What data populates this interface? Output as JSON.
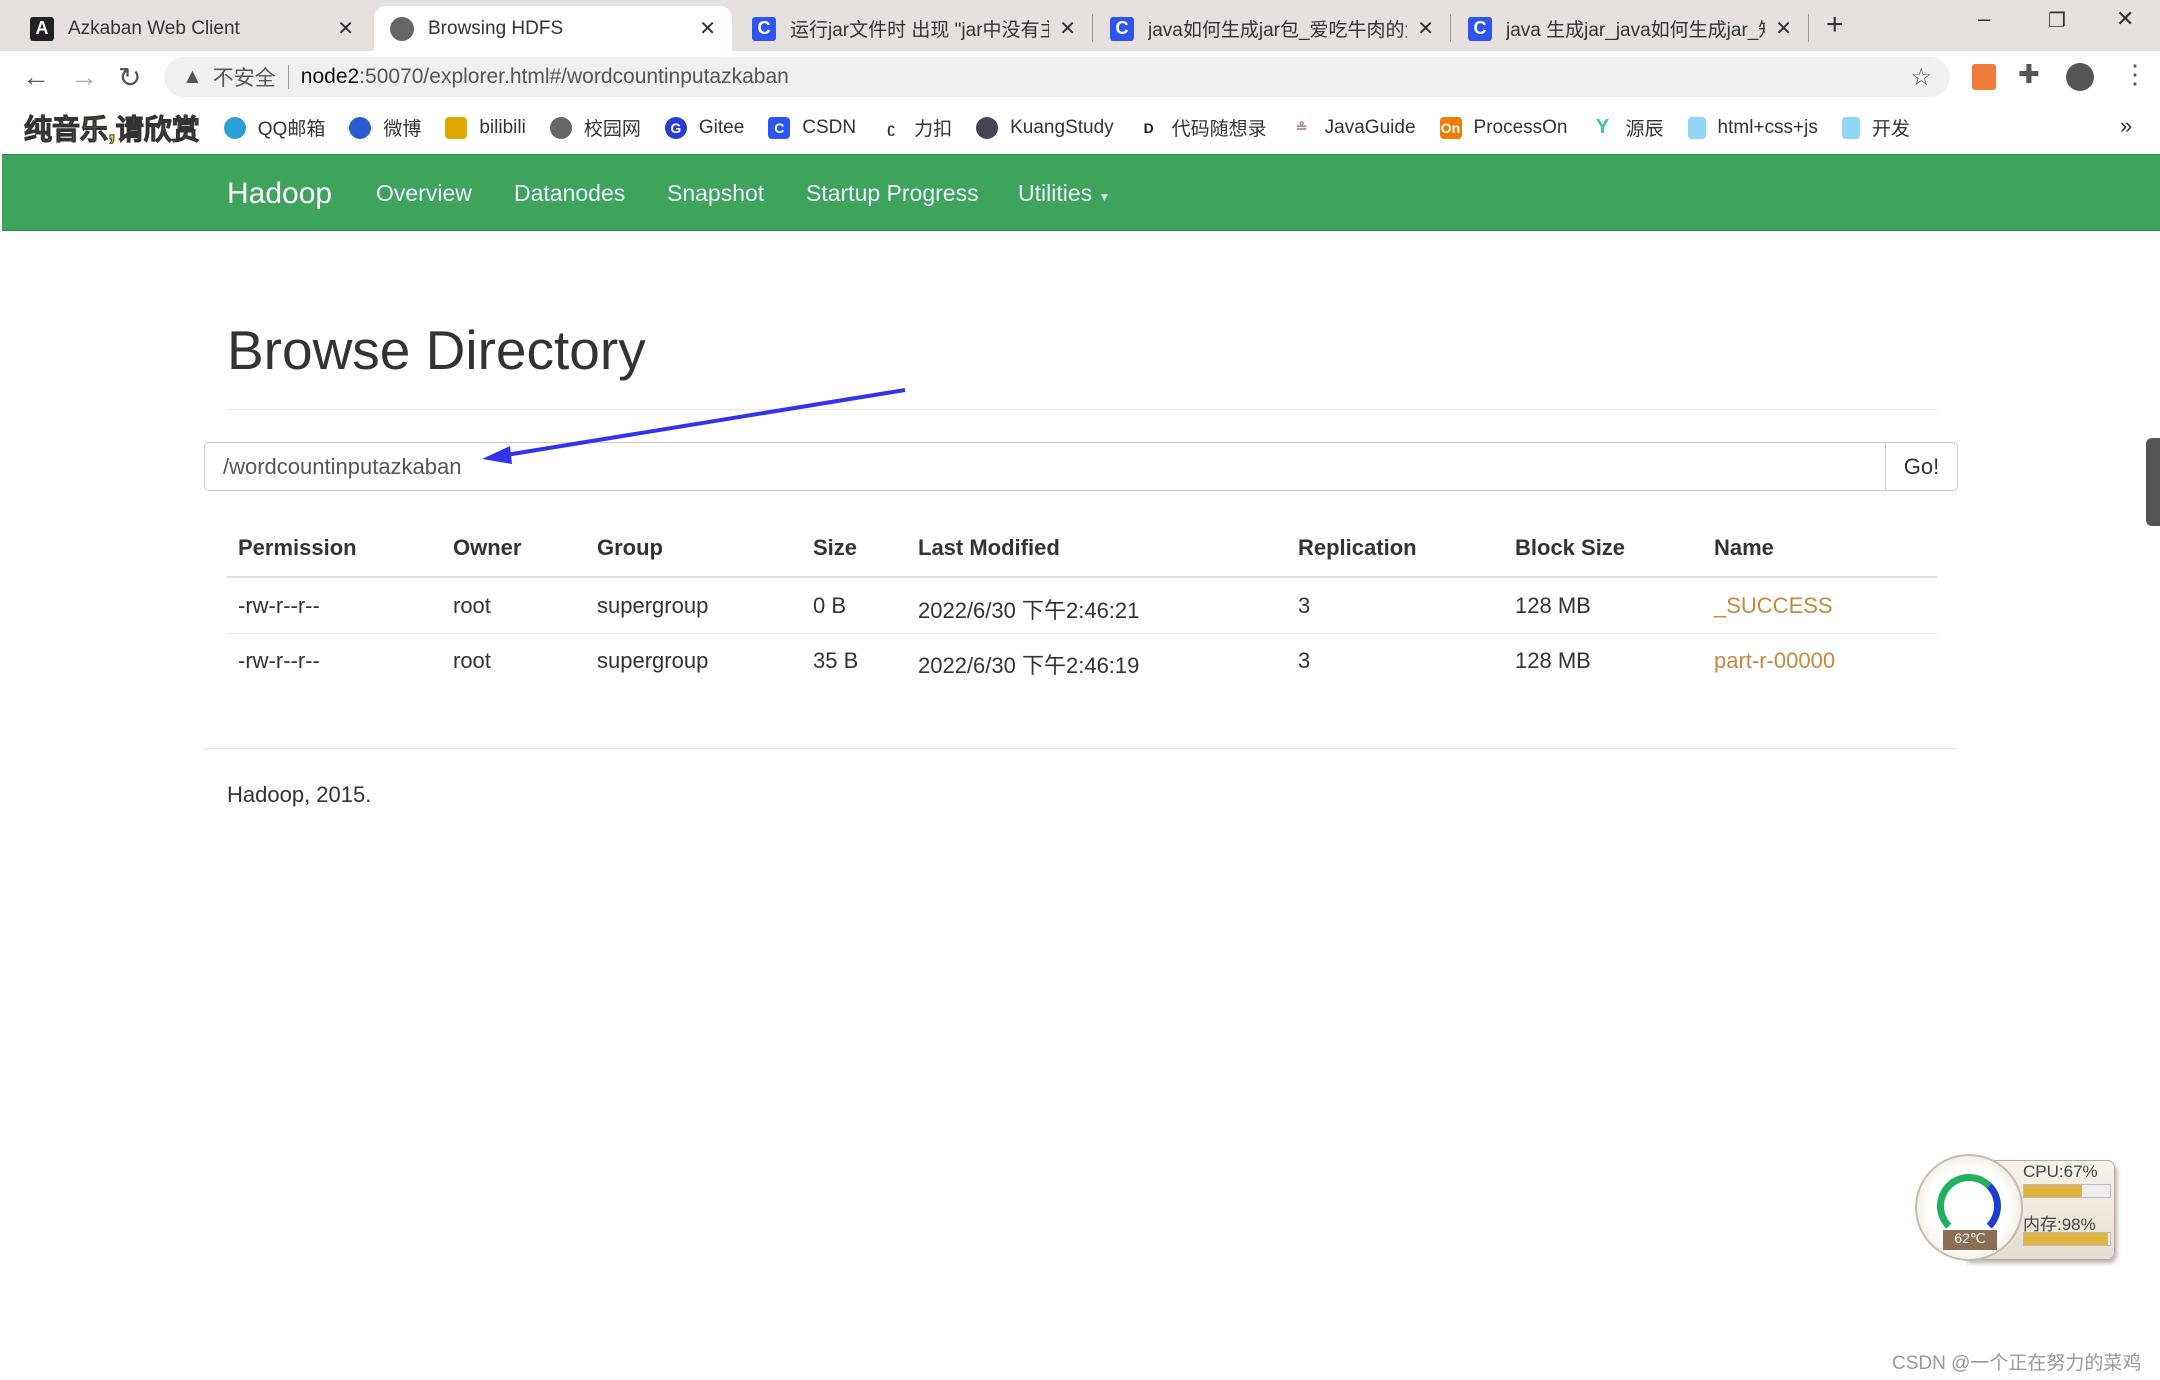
{
  "browser": {
    "tabs": [
      {
        "title": "Azkaban Web Client",
        "icon": "azkaban-icon"
      },
      {
        "title": "Browsing HDFS",
        "icon": "globe-icon",
        "active": true
      },
      {
        "title": "运行jar文件时 出现 \"jar中没有主",
        "icon": "csdn-icon"
      },
      {
        "title": "java如何生成jar包_爱吃牛肉的大",
        "icon": "csdn-icon"
      },
      {
        "title": "java 生成jar_java如何生成jar_知",
        "icon": "csdn-icon"
      }
    ],
    "security_label": "不安全",
    "url_host": "node2",
    "url_rest": ":50070/explorer.html#/wordcountinputazkaban",
    "bookmarks": [
      {
        "label": "纯音乐,请欣赏",
        "icon": "music-icon"
      },
      {
        "label": "QQ邮箱",
        "icon": "qqmail-icon",
        "color": "#2a9fd8"
      },
      {
        "label": "微博",
        "icon": "weibo-icon",
        "color": "#2b5bd0"
      },
      {
        "label": "bilibili",
        "icon": "bilibili-icon",
        "color": "#e0a800"
      },
      {
        "label": "校园网",
        "icon": "globe-icon",
        "color": "#666"
      },
      {
        "label": "Gitee",
        "icon": "gitee-icon",
        "color": "#2a3bd6"
      },
      {
        "label": "CSDN",
        "icon": "csdn-icon",
        "color": "#2f55f0"
      },
      {
        "label": "力扣",
        "icon": "leetcode-icon",
        "color": "#333"
      },
      {
        "label": "KuangStudy",
        "icon": "kuangstudy-icon",
        "color": "#445"
      },
      {
        "label": "代码随想录",
        "icon": "dmsxl-icon",
        "color": "#222"
      },
      {
        "label": "JavaGuide",
        "icon": "javaguide-icon",
        "color": "#b88"
      },
      {
        "label": "ProcessOn",
        "icon": "processon-icon",
        "color": "#f07c00"
      },
      {
        "label": "源辰",
        "icon": "yuanchen-icon",
        "color": "#3cc9a0"
      },
      {
        "label": "html+css+js",
        "icon": "folder-icon",
        "color": "#8fd6f7"
      },
      {
        "label": "开发",
        "icon": "folder-icon",
        "color": "#8fd6f7"
      }
    ]
  },
  "navbar": {
    "brand": "Hadoop",
    "items": [
      "Overview",
      "Datanodes",
      "Snapshot",
      "Startup Progress",
      "Utilities"
    ],
    "color": "#3ea45c"
  },
  "page": {
    "title": "Browse Directory",
    "path_value": "/wordcountinputazkaban",
    "go_label": "Go!",
    "table": {
      "headers": [
        "Permission",
        "Owner",
        "Group",
        "Size",
        "Last Modified",
        "Replication",
        "Block Size",
        "Name"
      ],
      "rows": [
        [
          "-rw-r--r--",
          "root",
          "supergroup",
          "0 B",
          "2022/6/30 下午2:46:21",
          "3",
          "128 MB",
          "_SUCCESS"
        ],
        [
          "-rw-r--r--",
          "root",
          "supergroup",
          "35 B",
          "2022/6/30 下午2:46:19",
          "3",
          "128 MB",
          "part-r-00000"
        ]
      ]
    },
    "footer": "Hadoop, 2015."
  },
  "widget": {
    "cpu": "CPU:67%",
    "cpu_fraction": 0.67,
    "mem": "内存:98%",
    "mem_fraction": 0.98,
    "temp": "62℃"
  },
  "watermark": "CSDN @一个正在努力的菜鸡",
  "annotation_color": "#3333ee"
}
